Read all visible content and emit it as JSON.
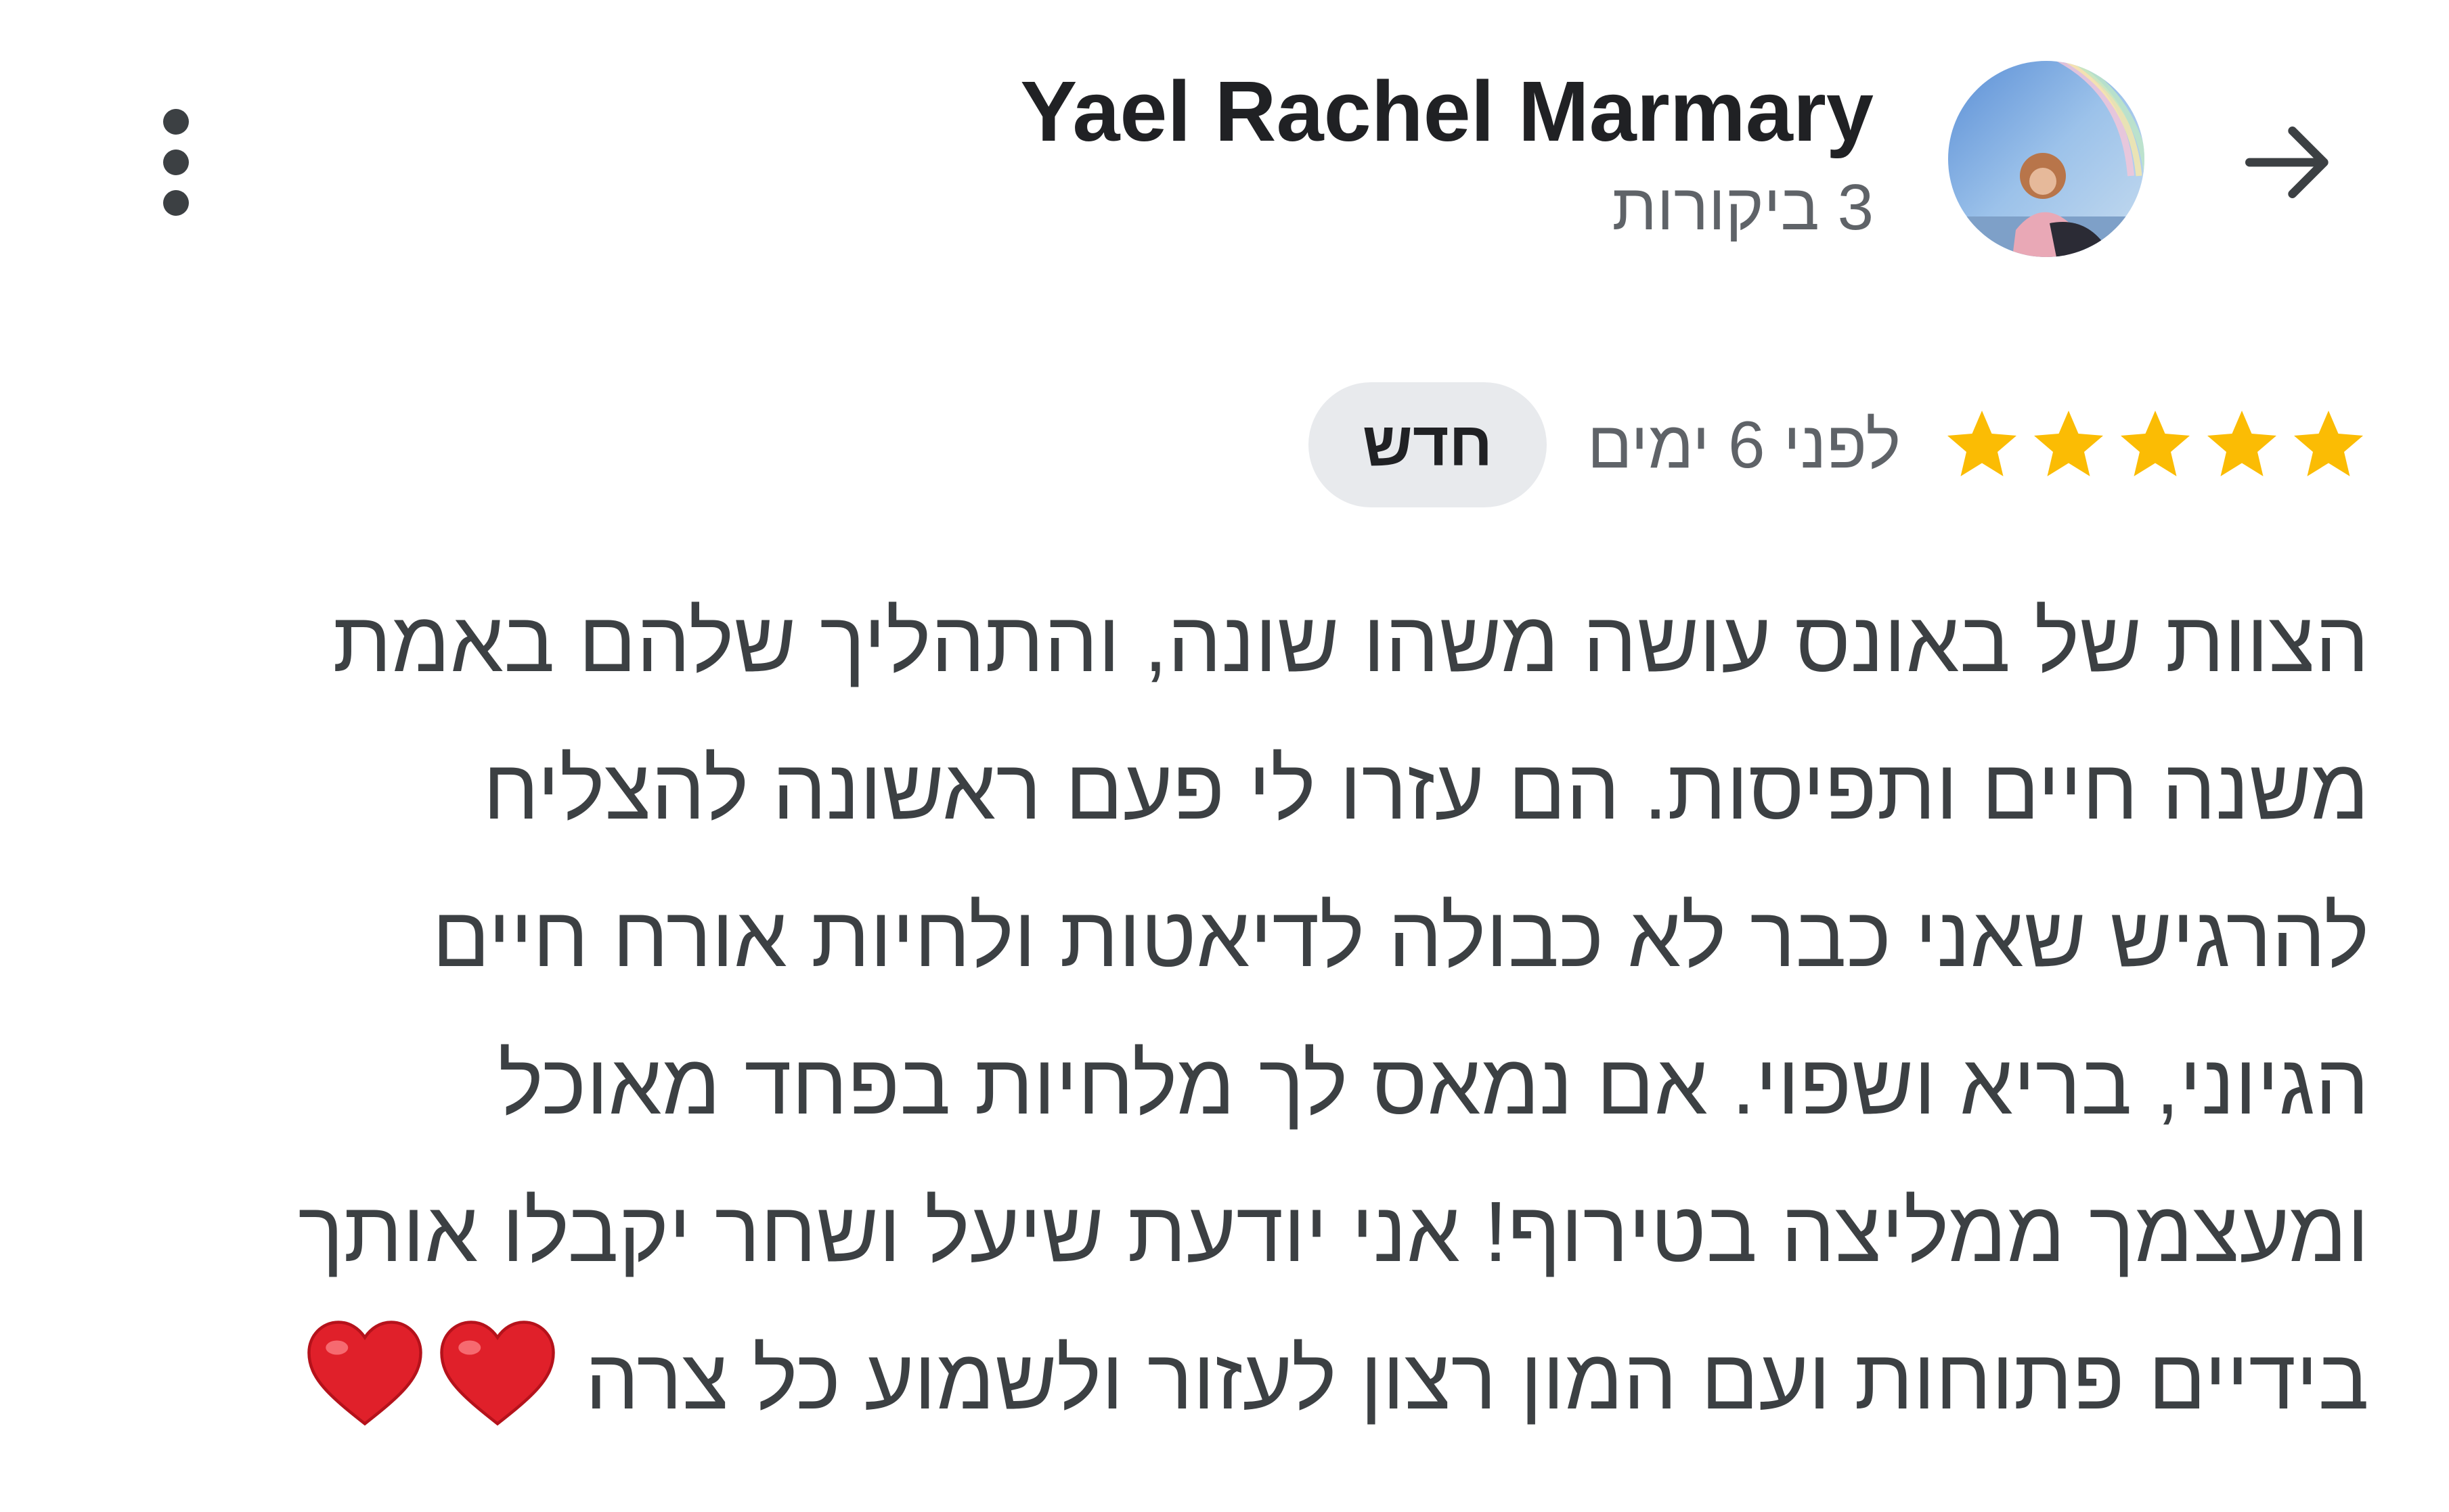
{
  "header": {
    "reviewer_name": "Yael Rachel Marmary",
    "review_count": "3 ביקורות"
  },
  "review": {
    "rating": 5,
    "rating_max": 5,
    "time_ago": "לפני 6 ימים",
    "badge": "חדש",
    "lines": [
      "הצוות של באונס עושה משהו שונה, והתהליך שלהם באמת",
      "משנה חיים ותפיסות. הם עזרו לי פעם ראשונה להצליח",
      "להרגיש שאני כבר לא כבולה לדיאטות ולחיות אורח חיים",
      "הגיוני, בריא ושפוי. אם נמאס לך מלחיות בפחד מאוכל",
      "ומעצמך ממליצה בטירוף! אני יודעת שיעל ושחר יקבלו אותך",
      "בידיים פתוחות ועם המון רצון לעזור ולשמוע כל צרה"
    ],
    "emoji": "❤️❤️"
  },
  "colors": {
    "star": "#fbbc04",
    "name_text": "#202124",
    "secondary_text": "#5f6368",
    "badge_bg": "#e8eaed",
    "icon": "#3c4043",
    "heart": "#e0202a"
  },
  "icons": {
    "back": "arrow-right-icon",
    "more": "more-vertical-icon",
    "star": "star-icon",
    "heart": "heart-icon"
  }
}
